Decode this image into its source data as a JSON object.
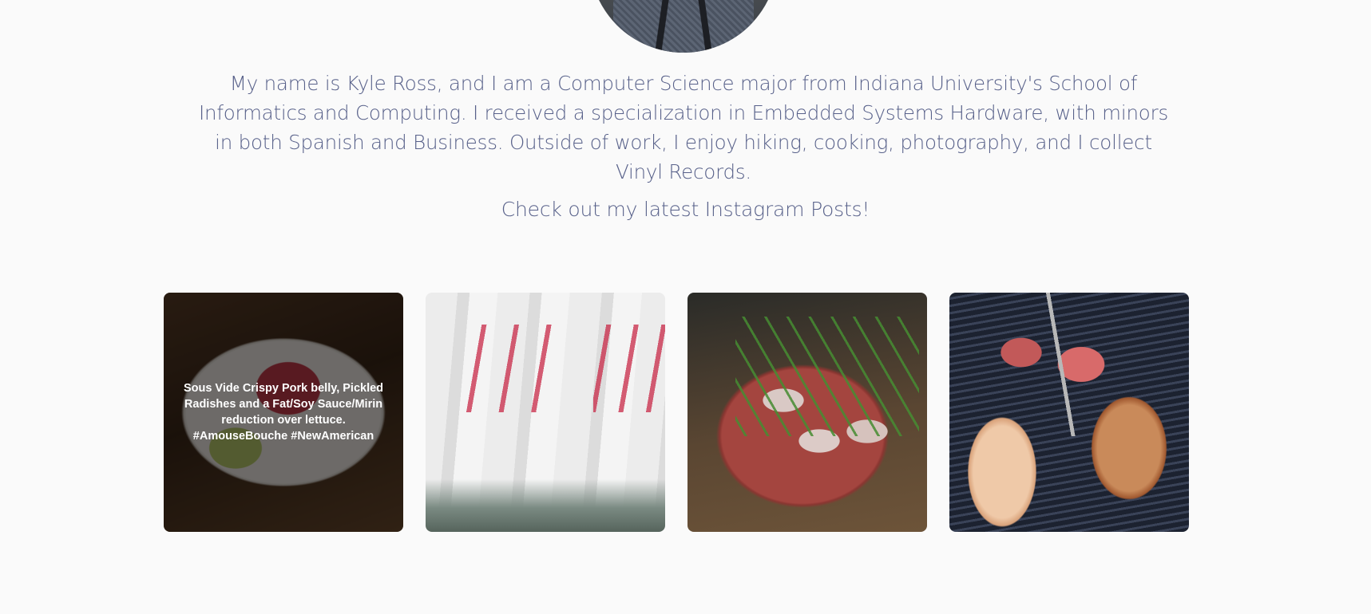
{
  "profile": {
    "bio": "My name is Kyle Ross, and I am a Computer Science major from Indiana University's School of Informatics and Computing. I received a specialization in Embedded Systems Hardware, with minors in both Spanish and Business. Outside of work, I enjoy hiking, cooking, photography, and I collect Vinyl Records.",
    "instagram_cta": "Check out my latest Instagram Posts!"
  },
  "instagram": {
    "posts": [
      {
        "caption": "Sous Vide Crispy Pork belly, Pickled Radishes and a Fat/Soy Sauce/Mirin reduction over lettuce. #AmouseBouche #NewAmerican"
      },
      {
        "caption": ""
      },
      {
        "caption": ""
      },
      {
        "caption": ""
      }
    ]
  },
  "colors": {
    "background": "#fafafa",
    "text": "#58618a"
  }
}
